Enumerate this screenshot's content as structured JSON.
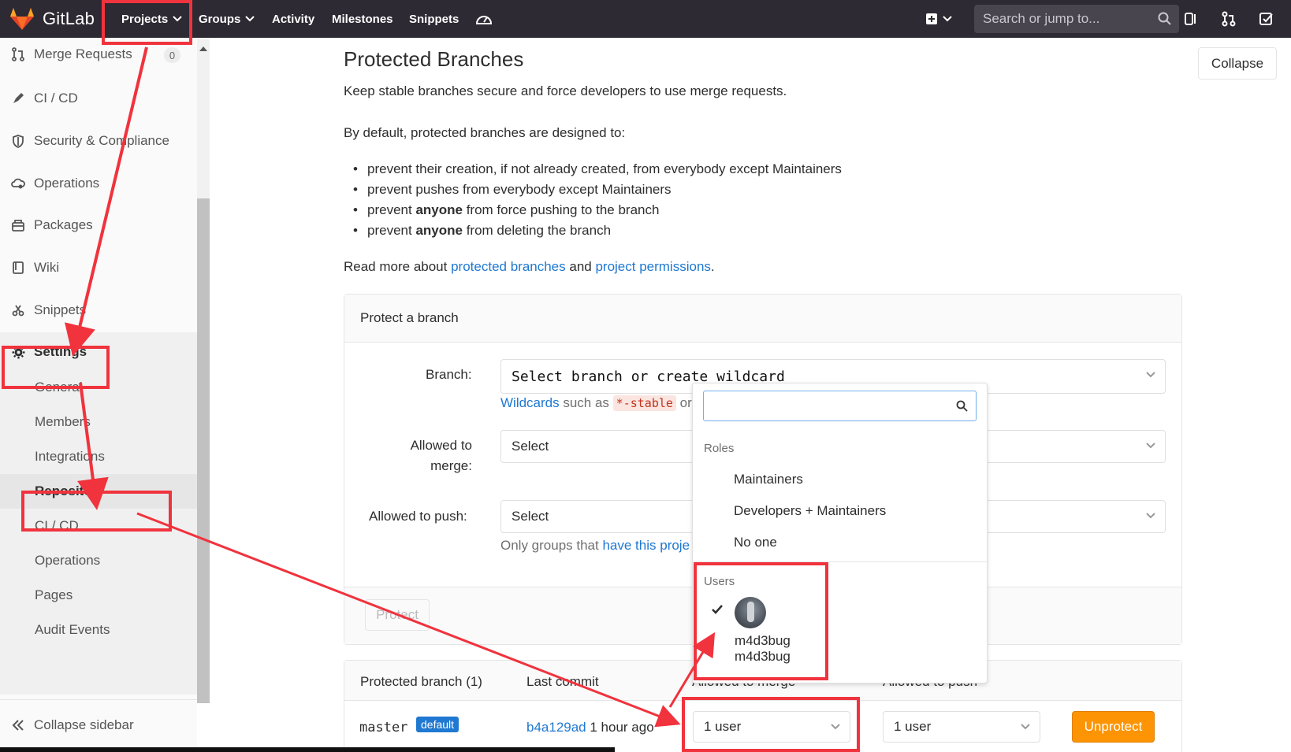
{
  "navbar": {
    "brand": "GitLab",
    "projects": "Projects",
    "groups": "Groups",
    "activity": "Activity",
    "milestones": "Milestones",
    "snippets": "Snippets",
    "search_placeholder": "Search or jump to..."
  },
  "sidebar": {
    "items": [
      {
        "label": "Merge Requests",
        "icon": "merge-request-icon",
        "badge": "0"
      },
      {
        "label": "CI / CD",
        "icon": "rocket-icon"
      },
      {
        "label": "Security & Compliance",
        "icon": "shield-icon"
      },
      {
        "label": "Operations",
        "icon": "cloud-gear-icon"
      },
      {
        "label": "Packages",
        "icon": "package-icon"
      },
      {
        "label": "Wiki",
        "icon": "book-icon"
      },
      {
        "label": "Snippets",
        "icon": "scissors-icon"
      },
      {
        "label": "Settings",
        "icon": "gear-icon"
      }
    ],
    "sub_items": [
      "General",
      "Members",
      "Integrations",
      "Repository",
      "CI / CD",
      "Operations",
      "Pages",
      "Audit Events"
    ],
    "collapse": "Collapse sidebar"
  },
  "main": {
    "title": "Protected Branches",
    "collapse_button": "Collapse",
    "intro": "Keep stable branches secure and force developers to use merge requests.",
    "default_text": "By default, protected branches are designed to:",
    "bullets": [
      {
        "pre": "prevent their creation, if not already created, from everybody except Maintainers",
        "bold": "",
        "post": ""
      },
      {
        "pre": "prevent pushes from everybody except Maintainers",
        "bold": "",
        "post": ""
      },
      {
        "pre": "prevent ",
        "bold": "anyone",
        "post": " from force pushing to the branch"
      },
      {
        "pre": "prevent ",
        "bold": "anyone",
        "post": " from deleting the branch"
      }
    ],
    "read_more": {
      "pre": "Read more about ",
      "link1": "protected branches",
      "mid": " and ",
      "link2": "project permissions",
      "post": "."
    },
    "protect_panel": {
      "header": "Protect a branch",
      "branch_label": "Branch:",
      "branch_value": "Select branch or create wildcard",
      "wildcards_link": "Wildcards",
      "wildcards_text": " such as ",
      "wildcards_code": "*-stable",
      "wildcards_more": " or",
      "merge_label_1": "Allowed to",
      "merge_label_2": "merge:",
      "merge_value": "Select",
      "push_label": "Allowed to push:",
      "push_value": "Select",
      "groups_hint_pre": "Only groups that ",
      "groups_hint_link": "have this proje",
      "protect_button": "Protect"
    },
    "table": {
      "header_branch": "Protected branch (1)",
      "header_commit": "Last commit",
      "header_merge": "Allowed to merge",
      "header_push": "Allowed to push",
      "row": {
        "branch": "master",
        "badge": "default",
        "commit_sha": "b4a129ad",
        "commit_time": " 1 hour ago",
        "merge_value": "1 user",
        "push_value": "1 user",
        "unprotect": "Unprotect"
      }
    }
  },
  "dropdown": {
    "search_value": "",
    "roles_header": "Roles",
    "roles": [
      "Maintainers",
      "Developers + Maintainers",
      "No one"
    ],
    "users_header": "Users",
    "user_name": "m4d3bug",
    "user_username": "m4d3bug"
  },
  "colors": {
    "navbar": "#2d2a33",
    "link": "#1f78d1",
    "annotation": "#f0333d",
    "unprotect": "#fc9403"
  }
}
